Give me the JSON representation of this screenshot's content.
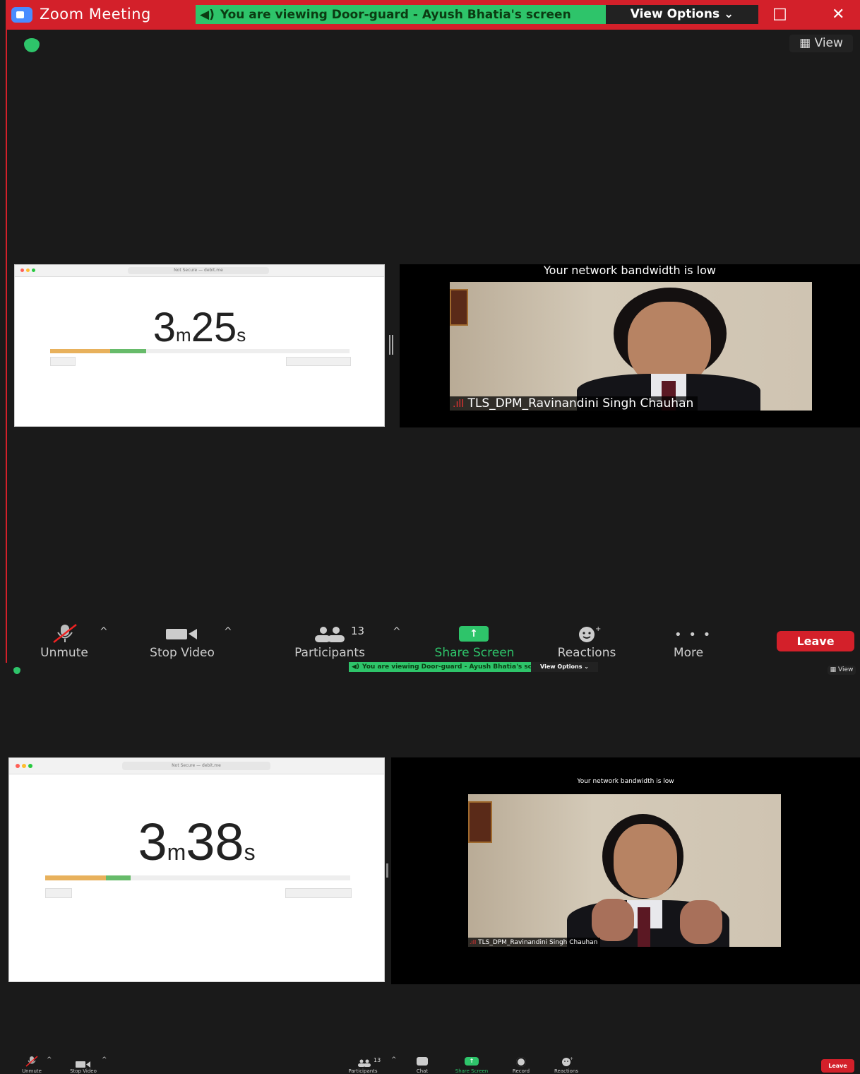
{
  "window": {
    "title": "Zoom Meeting",
    "maximize_icon": "□",
    "close_icon": "✕"
  },
  "banner": {
    "text": "You are viewing Door-guard - Ayush Bhatia's screen",
    "view_options": "View Options ⌄"
  },
  "view_button": "View",
  "screens": [
    {
      "url": "Not Secure — debit.me",
      "minutes": "3",
      "m_unit": "m",
      "seconds": "25",
      "s_unit": "s",
      "progress_orange": 0.2,
      "progress_green": 0.12
    },
    {
      "url": "Not Secure — debit.me",
      "minutes": "3",
      "m_unit": "m",
      "seconds": "38",
      "s_unit": "s",
      "progress_orange": 0.2,
      "progress_green": 0.08
    }
  ],
  "video": {
    "bandwidth_notice": "Your network bandwidth is low",
    "participant_name": "TLS_DPM_Ravinandini Singh Chauhan"
  },
  "toolbar": {
    "unmute": "Unmute",
    "stop_video": "Stop Video",
    "participants": "Participants",
    "participants_count": "13",
    "share_screen": "Share Screen",
    "reactions": "Reactions",
    "more": "More",
    "leave": "Leave",
    "chat": "Chat",
    "record": "Record"
  },
  "colors": {
    "title_bar": "#d3202a",
    "banner": "#2ec46a",
    "leave": "#d3202a",
    "background": "#1a1a1a"
  }
}
